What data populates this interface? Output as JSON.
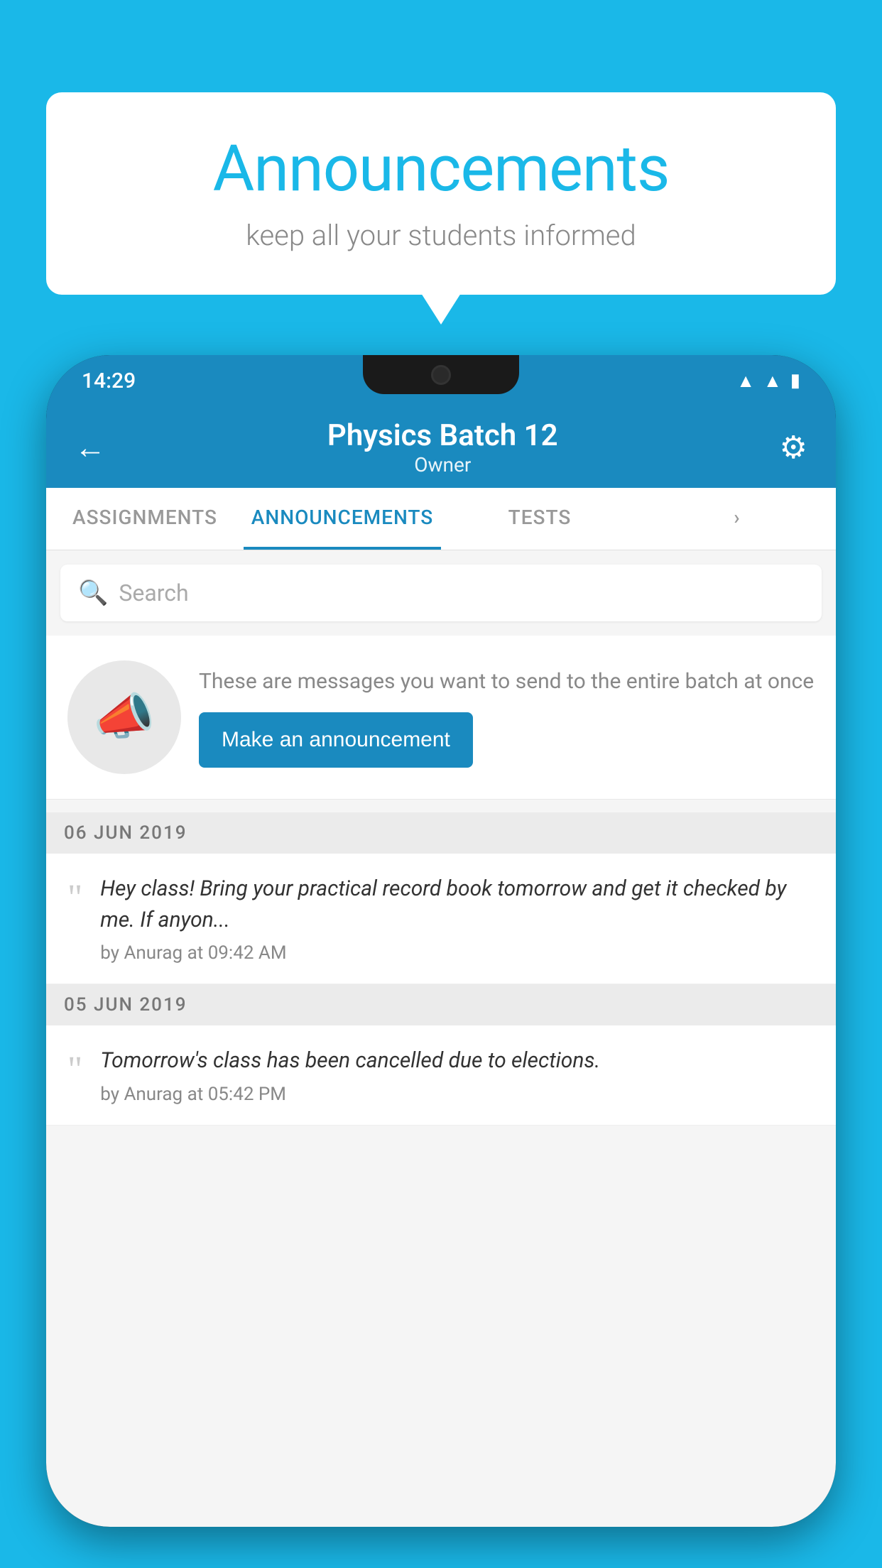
{
  "background_color": "#1ab8e8",
  "speech_bubble": {
    "title": "Announcements",
    "subtitle": "keep all your students informed"
  },
  "status_bar": {
    "time": "14:29",
    "icons": [
      "wifi",
      "signal",
      "battery"
    ]
  },
  "app_bar": {
    "title": "Physics Batch 12",
    "subtitle": "Owner",
    "back_label": "←",
    "gear_label": "⚙"
  },
  "tabs": [
    {
      "label": "ASSIGNMENTS",
      "active": false
    },
    {
      "label": "ANNOUNCEMENTS",
      "active": true
    },
    {
      "label": "TESTS",
      "active": false
    },
    {
      "label": "",
      "active": false
    }
  ],
  "search": {
    "placeholder": "Search"
  },
  "promo": {
    "description": "These are messages you want to send to the entire batch at once",
    "button_label": "Make an announcement"
  },
  "announcements": [
    {
      "date": "06  JUN  2019",
      "text": "Hey class! Bring your practical record book tomorrow and get it checked by me. If anyon...",
      "meta": "by Anurag at 09:42 AM"
    },
    {
      "date": "05  JUN  2019",
      "text": "Tomorrow's class has been cancelled due to elections.",
      "meta": "by Anurag at 05:42 PM"
    }
  ]
}
